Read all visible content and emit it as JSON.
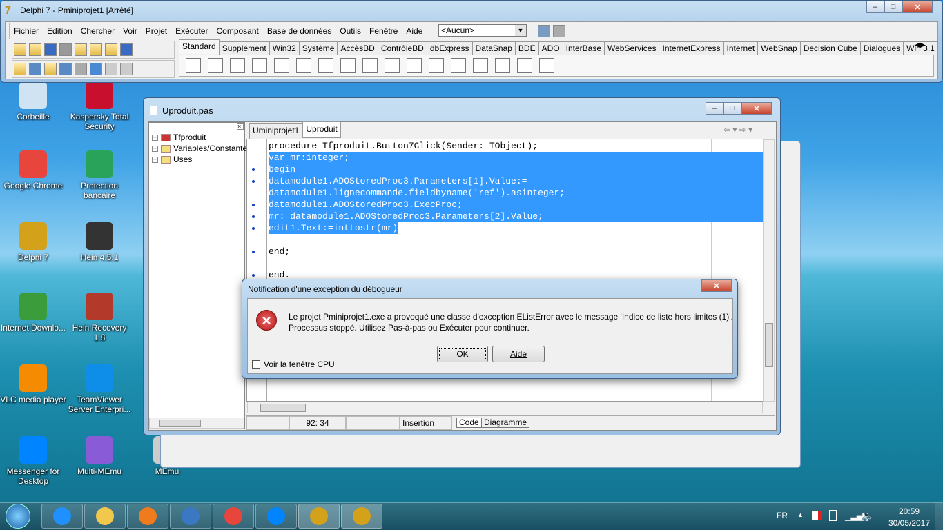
{
  "main_window": {
    "title": "Delphi 7 - Pminiprojet1 [Arrêté]",
    "menu": [
      "Fichier",
      "Edition",
      "Chercher",
      "Voir",
      "Projet",
      "Exécuter",
      "Composant",
      "Base de données",
      "Outils",
      "Fenêtre",
      "Aide"
    ],
    "config_select": "<Aucun>",
    "palette_tabs": [
      "Standard",
      "Supplément",
      "Win32",
      "Système",
      "AccèsBD",
      "ContrôleBD",
      "dbExpress",
      "DataSnap",
      "BDE",
      "ADO",
      "InterBase",
      "WebServices",
      "InternetExpress",
      "Internet",
      "WebSnap",
      "Decision Cube",
      "Dialogues",
      "Win 3.1"
    ],
    "active_tab": "Standard"
  },
  "desktop_icons": [
    {
      "label": "Corbeille",
      "color": "#cfe3f2"
    },
    {
      "label": "Kaspersky Total Security",
      "color": "#c8102e"
    },
    {
      "label": "Google Chrome",
      "color": "#e8453c"
    },
    {
      "label": "Protection bancaire",
      "color": "#2aa35a"
    },
    {
      "label": "Delphi 7",
      "color": "#d4a11b"
    },
    {
      "label": "Hein 4.5.1",
      "color": "#333333"
    },
    {
      "label": "Internet Downlo...",
      "color": "#3a9c3a"
    },
    {
      "label": "Hein Recovery 1.8",
      "color": "#b33a2a"
    },
    {
      "label": "VLC media player",
      "color": "#f48b00"
    },
    {
      "label": "TeamViewer Server Enterpri...",
      "color": "#0e8ee9"
    },
    {
      "label": "Messenger for Desktop",
      "color": "#0084ff"
    },
    {
      "label": "Multi-MEmu",
      "color": "#8a5bd6"
    },
    {
      "label": "MEmu",
      "color": "#cccccc"
    }
  ],
  "editor": {
    "title": "Uproduit.pas",
    "tree": [
      "Tfproduit",
      "Variables/Constantes",
      "Uses"
    ],
    "tabs": [
      "Uminiprojet1",
      "Uproduit"
    ],
    "active_tab": "Uproduit",
    "code": [
      {
        "text": "procedure Tfproduit.Button7Click(Sender: TObject);",
        "sel": false,
        "dot": false
      },
      {
        "text": "var mr:integer;",
        "sel": true,
        "dot": false
      },
      {
        "text": "begin",
        "sel": true,
        "dot": true
      },
      {
        "text": "datamodule1.ADOStoredProc3.Parameters[1].Value:=",
        "sel": true,
        "dot": true
      },
      {
        "text": "datamodule1.lignecommande.fieldbyname('ref').asinteger;",
        "sel": true,
        "dot": false
      },
      {
        "text": "datamodule1.ADOStoredProc3.ExecProc;",
        "sel": true,
        "dot": true
      },
      {
        "text": "mr:=datamodule1.ADOStoredProc3.Parameters[2].Value;",
        "sel": true,
        "dot": true
      },
      {
        "text": "edit1.Text:=inttostr(mr)",
        "sel": true,
        "dot": true
      },
      {
        "text": "",
        "sel": false,
        "dot": false
      },
      {
        "text": "end;",
        "sel": false,
        "dot": true
      },
      {
        "text": "",
        "sel": false,
        "dot": false
      },
      {
        "text": "end.",
        "sel": false,
        "dot": true
      }
    ],
    "status": {
      "position": "92: 34",
      "mode": "Insertion",
      "tab_code": "Code",
      "tab_diagram": "Diagramme"
    }
  },
  "dialog": {
    "title": "Notification d'une exception du débogueur",
    "message_line1": "Le projet Pminiprojet1.exe a provoqué une classe d'exception EListError avec le message 'Indice de liste hors limites (1)'.",
    "message_line2": "Processus stoppé. Utilisez Pas-à-pas ou Exécuter pour continuer.",
    "ok": "OK",
    "help": "Aide",
    "checkbox": "Voir la fenêtre CPU",
    "checked": false
  },
  "taskbar": {
    "lang": "FR",
    "time": "20:59",
    "date": "30/05/2017",
    "apps": [
      {
        "name": "internet-explorer",
        "color": "#1e90ff"
      },
      {
        "name": "file-explorer",
        "color": "#f1c84b"
      },
      {
        "name": "media-player",
        "color": "#f07b1d"
      },
      {
        "name": "teamviewer-qs",
        "color": "#3a78c4"
      },
      {
        "name": "chrome",
        "color": "#e8453c"
      },
      {
        "name": "messenger",
        "color": "#0084ff"
      },
      {
        "name": "delphi-7",
        "color": "#d4a11b"
      },
      {
        "name": "delphi-7-debug",
        "color": "#d4a11b"
      }
    ]
  }
}
